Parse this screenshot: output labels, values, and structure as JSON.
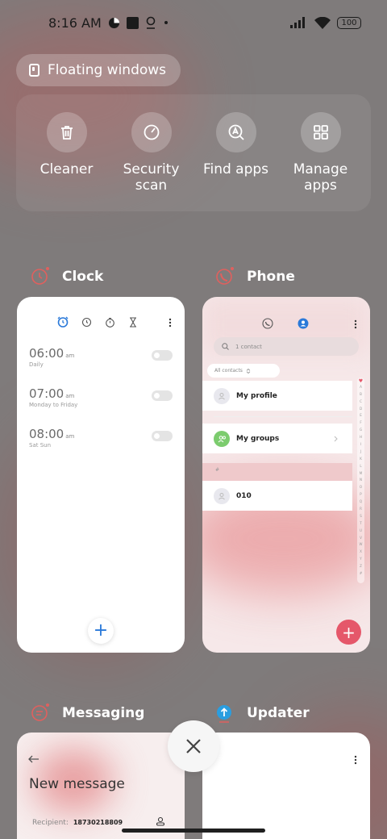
{
  "status_bar": {
    "time": "8:16 AM",
    "battery": "100"
  },
  "floating_windows": {
    "label": "Floating windows"
  },
  "quick_actions": [
    {
      "label": "Cleaner",
      "icon": "trash-icon"
    },
    {
      "label": "Security\nscan",
      "icon": "security-scan-icon"
    },
    {
      "label": "Find apps",
      "icon": "find-apps-icon"
    },
    {
      "label": "Manage\napps",
      "icon": "grid-icon"
    }
  ],
  "apps": {
    "clock": {
      "name": "Clock",
      "alarms": [
        {
          "time": "06:00",
          "ampm": "am",
          "days": "Daily"
        },
        {
          "time": "07:00",
          "ampm": "am",
          "days": "Monday to Friday"
        },
        {
          "time": "08:00",
          "ampm": "am",
          "days": "Sat Sun"
        }
      ],
      "fab": "+"
    },
    "phone": {
      "name": "Phone",
      "search_placeholder": "1 contact",
      "filter_chip": "All contacts",
      "rows": {
        "profile": "My profile",
        "groups": "My groups",
        "section": "#",
        "contact": "010"
      },
      "alphabet": [
        "A",
        "B",
        "C",
        "D",
        "E",
        "F",
        "G",
        "H",
        "I",
        "J",
        "K",
        "L",
        "M",
        "N",
        "O",
        "P",
        "Q",
        "R",
        "S",
        "T",
        "U",
        "V",
        "W",
        "X",
        "Y",
        "Z",
        "#"
      ],
      "fab": "+"
    },
    "messaging": {
      "name": "Messaging",
      "title": "New message",
      "recipient_label": "Recipient:",
      "recipient_value": "18730218809"
    },
    "updater": {
      "name": "Updater"
    }
  },
  "colors": {
    "accent_blue": "#2a79d9",
    "accent_red": "#e5576a",
    "green": "#7ccc6e"
  }
}
